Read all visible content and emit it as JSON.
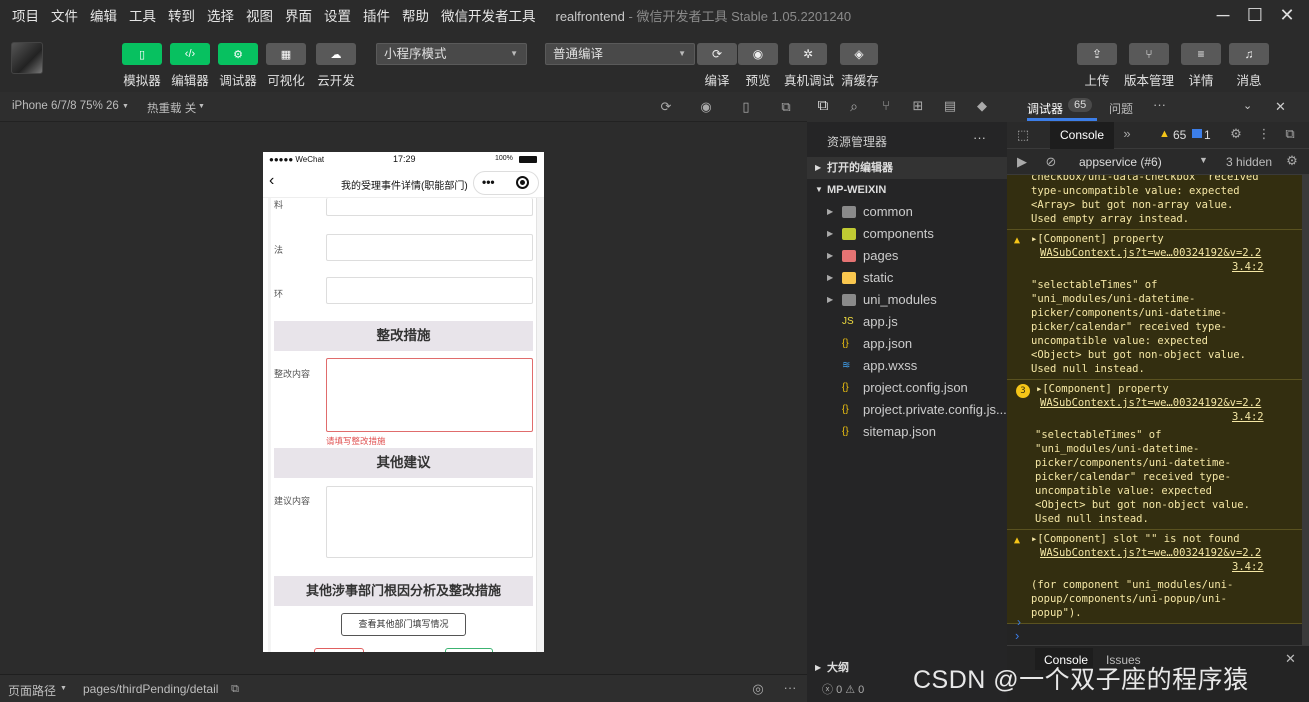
{
  "menubar": {
    "items": [
      "项目",
      "文件",
      "编辑",
      "工具",
      "转到",
      "选择",
      "视图",
      "界面",
      "设置",
      "插件",
      "帮助",
      "微信开发者工具"
    ],
    "title": "realfrontend",
    "subtitle": "- 微信开发者工具 Stable 1.05.2201240"
  },
  "toolbar": {
    "buttons": [
      {
        "label": "模拟器",
        "icon": "phone-icon"
      },
      {
        "label": "编辑器",
        "icon": "code-icon"
      },
      {
        "label": "调试器",
        "icon": "debug-icon"
      },
      {
        "label": "可视化",
        "icon": "layout-icon"
      },
      {
        "label": "云开发",
        "icon": "cloud-icon"
      }
    ],
    "mode_select": "小程序模式",
    "compile_select": "普通编译",
    "actions": [
      {
        "label": "编译",
        "icon": "refresh-icon"
      },
      {
        "label": "预览",
        "icon": "eye-icon"
      },
      {
        "label": "真机调试",
        "icon": "bug-icon"
      },
      {
        "label": "清缓存",
        "icon": "layers-icon"
      }
    ],
    "right_actions": [
      {
        "label": "上传",
        "icon": "upload-icon"
      },
      {
        "label": "版本管理",
        "icon": "branch-icon"
      },
      {
        "label": "详情",
        "icon": "menu-icon"
      },
      {
        "label": "消息",
        "icon": "bell-icon"
      }
    ]
  },
  "subbar": {
    "device": "iPhone 6/7/8 75% 26",
    "hotreload": "热重载 关"
  },
  "phone": {
    "status_left": "●●●●● WeChat",
    "status_time": "17:29",
    "status_battery": "100%",
    "nav_title": "我的受理事件详情(职能部门)",
    "rows": [
      {
        "label": "料"
      },
      {
        "label": "法"
      },
      {
        "label": "环"
      }
    ],
    "section1": "整改措施",
    "content_label1": "整改内容",
    "error_text": "请填写整改措施",
    "section2": "其他建议",
    "content_label2": "建议内容",
    "section3": "其他涉事部门根因分析及整改措施",
    "view_button": "查看其他部门填写情况"
  },
  "statusbar": {
    "path_label": "页面路径",
    "path": "pages/thirdPending/detail",
    "errors": "0",
    "warnings": "0"
  },
  "explorer": {
    "header": "资源管理器",
    "section_open": "打开的编辑器",
    "section_project": "MP-WEIXIN",
    "files": [
      {
        "name": "common",
        "type": "folder",
        "color": "#8a8a8a"
      },
      {
        "name": "components",
        "type": "folder",
        "color": "#c0ca33"
      },
      {
        "name": "pages",
        "type": "folder",
        "color": "#e57373"
      },
      {
        "name": "static",
        "type": "folder",
        "color": "#f9c74f"
      },
      {
        "name": "uni_modules",
        "type": "folder",
        "color": "#8a8a8a"
      },
      {
        "name": "app.js",
        "type": "js",
        "color": "#f1dd3f"
      },
      {
        "name": "app.json",
        "type": "json",
        "color": "#f1c40f"
      },
      {
        "name": "app.wxss",
        "type": "wxss",
        "color": "#42a5f5"
      },
      {
        "name": "project.config.json",
        "type": "json",
        "color": "#f1c40f"
      },
      {
        "name": "project.private.config.js...",
        "type": "json",
        "color": "#f1c40f"
      },
      {
        "name": "sitemap.json",
        "type": "json",
        "color": "#f1c40f"
      }
    ],
    "outline": "大纲"
  },
  "devtools": {
    "tab_debugger": "调试器",
    "badge": "65",
    "tab_issues": "问题",
    "console_tab": "Console",
    "warn_count": "65",
    "info_count": "1",
    "context": "appservice (#6)",
    "hidden": "3 hidden",
    "bottom_tabs": [
      "Console",
      "Issues"
    ]
  },
  "console_messages": [
    {
      "lines": [
        "checkbox/uni-data-checkbox\" received",
        "type-uncompatible value: expected",
        "<Array> but got non-array value.",
        "Used empty array instead."
      ]
    },
    {
      "head": "▸[Component] property",
      "link": "WASubContext.js?t=we…00324192&v=2.2",
      "link2": "3.4:2",
      "lines": [
        "\"selectableTimes\" of",
        "\"uni_modules/uni-datetime-",
        "picker/components/uni-datetime-",
        "picker/calendar\" received type-",
        "uncompatible value: expected",
        "<Object> but got non-object value.",
        "Used null instead."
      ]
    },
    {
      "head": "▸[Component] property",
      "link": "WASubContext.js?t=we…00324192&v=2.2",
      "link2": "3.4:2",
      "badge": "3",
      "lines": [
        "\"selectableTimes\" of",
        "\"uni_modules/uni-datetime-",
        "picker/components/uni-datetime-",
        "picker/calendar\" received type-",
        "uncompatible value: expected",
        "<Object> but got non-object value.",
        "Used null instead."
      ]
    },
    {
      "head": "▸[Component] slot \"\" is not found",
      "link": "WASubContext.js?t=we…00324192&v=2.2",
      "link2": "3.4:2",
      "lines": [
        "(for component \"uni_modules/uni-",
        "popup/components/uni-popup/uni-",
        "popup\")."
      ]
    }
  ],
  "watermark": "CSDN @一个双子座的程序猿"
}
